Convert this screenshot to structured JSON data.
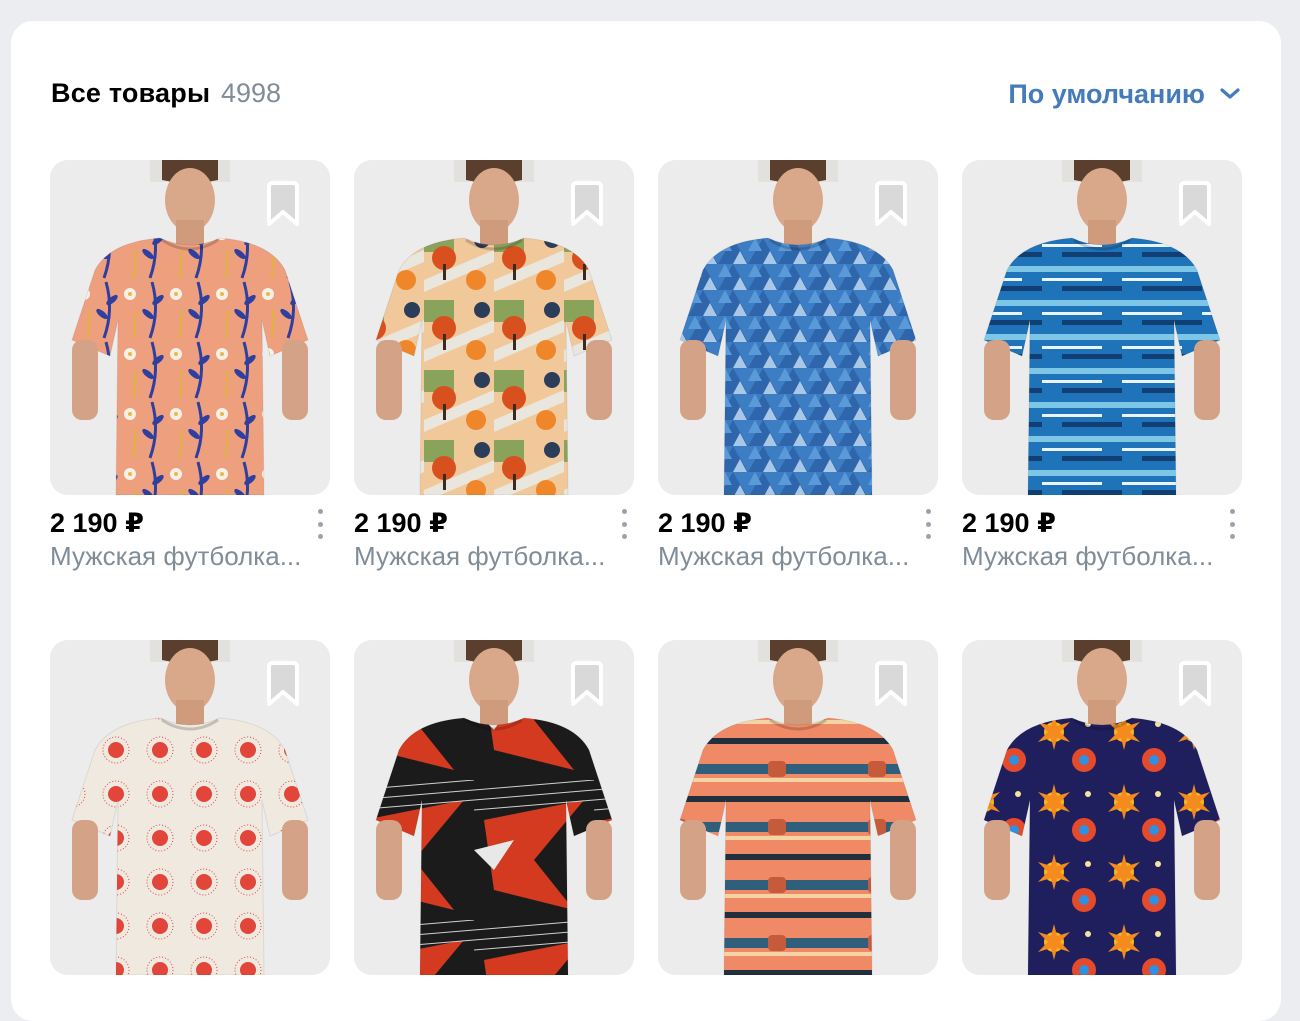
{
  "header": {
    "title": "Все товары",
    "count": "4998",
    "sort_label": "По умолчанию",
    "accent": "#447bba"
  },
  "products": [
    {
      "price": "2 190 ₽",
      "name": "Мужская футболка...",
      "pattern": "peach-floral",
      "base": "#ee9f7e",
      "accent": "#2f3fa0"
    },
    {
      "price": "2 190 ₽",
      "name": "Мужская футболка...",
      "pattern": "autumn-park",
      "base": "#f1c89a",
      "accent": "#d9501f"
    },
    {
      "price": "2 190 ₽",
      "name": "Мужская футболка...",
      "pattern": "blue-triangles",
      "base": "#3d7dc4",
      "accent": "#a9c8e8"
    },
    {
      "price": "2 190 ₽",
      "name": "Мужская футболка...",
      "pattern": "ocean-stripes",
      "base": "#1f73b8",
      "accent": "#7dc6e6"
    },
    {
      "price": "",
      "name": "",
      "pattern": "red-dots",
      "base": "#efe9df",
      "accent": "#e2463a"
    },
    {
      "price": "",
      "name": "",
      "pattern": "black-red-abstract",
      "base": "#1b1b1b",
      "accent": "#d43a1f"
    },
    {
      "price": "",
      "name": "",
      "pattern": "orange-stripes",
      "base": "#f08a66",
      "accent": "#2f5f7a"
    },
    {
      "price": "",
      "name": "",
      "pattern": "space-suns",
      "base": "#1f1f5e",
      "accent": "#f5b81c"
    }
  ]
}
